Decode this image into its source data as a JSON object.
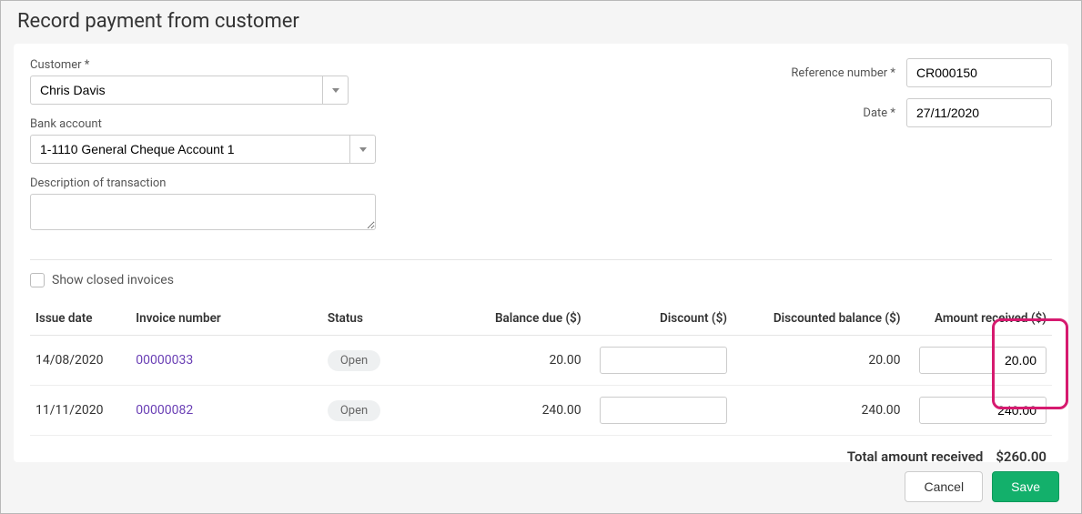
{
  "title": "Record payment from customer",
  "labels": {
    "customer": "Customer *",
    "bank_account": "Bank account",
    "description": "Description of transaction",
    "reference": "Reference number *",
    "date": "Date *",
    "show_closed": "Show closed invoices",
    "total_received": "Total amount received"
  },
  "form": {
    "customer": "Chris Davis",
    "bank_account": "1-1110 General Cheque Account 1",
    "description": "",
    "reference": "CR000150",
    "date": "27/11/2020"
  },
  "columns": {
    "issue_date": "Issue date",
    "invoice_number": "Invoice number",
    "status": "Status",
    "balance_due": "Balance due ($)",
    "discount": "Discount ($)",
    "discounted_balance": "Discounted balance ($)",
    "amount_received": "Amount received ($)"
  },
  "rows": [
    {
      "issue_date": "14/08/2020",
      "invoice_number": "00000033",
      "status": "Open",
      "balance_due": "20.00",
      "discount": "",
      "discounted_balance": "20.00",
      "amount_received": "20.00"
    },
    {
      "issue_date": "11/11/2020",
      "invoice_number": "00000082",
      "status": "Open",
      "balance_due": "240.00",
      "discount": "",
      "discounted_balance": "240.00",
      "amount_received": "240.00"
    }
  ],
  "total": "$260.00",
  "buttons": {
    "cancel": "Cancel",
    "save": "Save"
  }
}
